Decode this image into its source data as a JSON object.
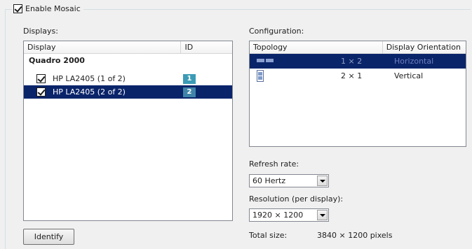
{
  "enable_mosaic": {
    "label": "Enable Mosaic",
    "checked": true
  },
  "displays": {
    "label": "Displays:",
    "columns": [
      "Display",
      "ID"
    ],
    "group": "Quadro 2000",
    "items": [
      {
        "name": "HP LA2405 (1 of 2)",
        "id": "1",
        "checked": true,
        "selected": false
      },
      {
        "name": "HP LA2405 (2 of 2)",
        "id": "2",
        "checked": true,
        "selected": true
      }
    ]
  },
  "identify_button": "Identify",
  "configuration": {
    "label": "Configuration:",
    "columns": [
      "Topology",
      "Display Orientation"
    ],
    "rows": [
      {
        "topology": "1 × 2",
        "orientation": "Horizontal",
        "icon": "horizontal-topology-icon",
        "selected": true
      },
      {
        "topology": "2 × 1",
        "orientation": "Vertical",
        "icon": "vertical-topology-icon",
        "selected": false
      }
    ]
  },
  "refresh_rate": {
    "label": "Refresh rate:",
    "value": "60 Hertz"
  },
  "resolution": {
    "label": "Resolution (per display):",
    "value": "1920 × 1200"
  },
  "total_size": {
    "label": "Total size:",
    "value": "3840 × 1200 pixels"
  },
  "colors": {
    "selection": "#0a246a",
    "id_badge": "#3b9bb5"
  }
}
